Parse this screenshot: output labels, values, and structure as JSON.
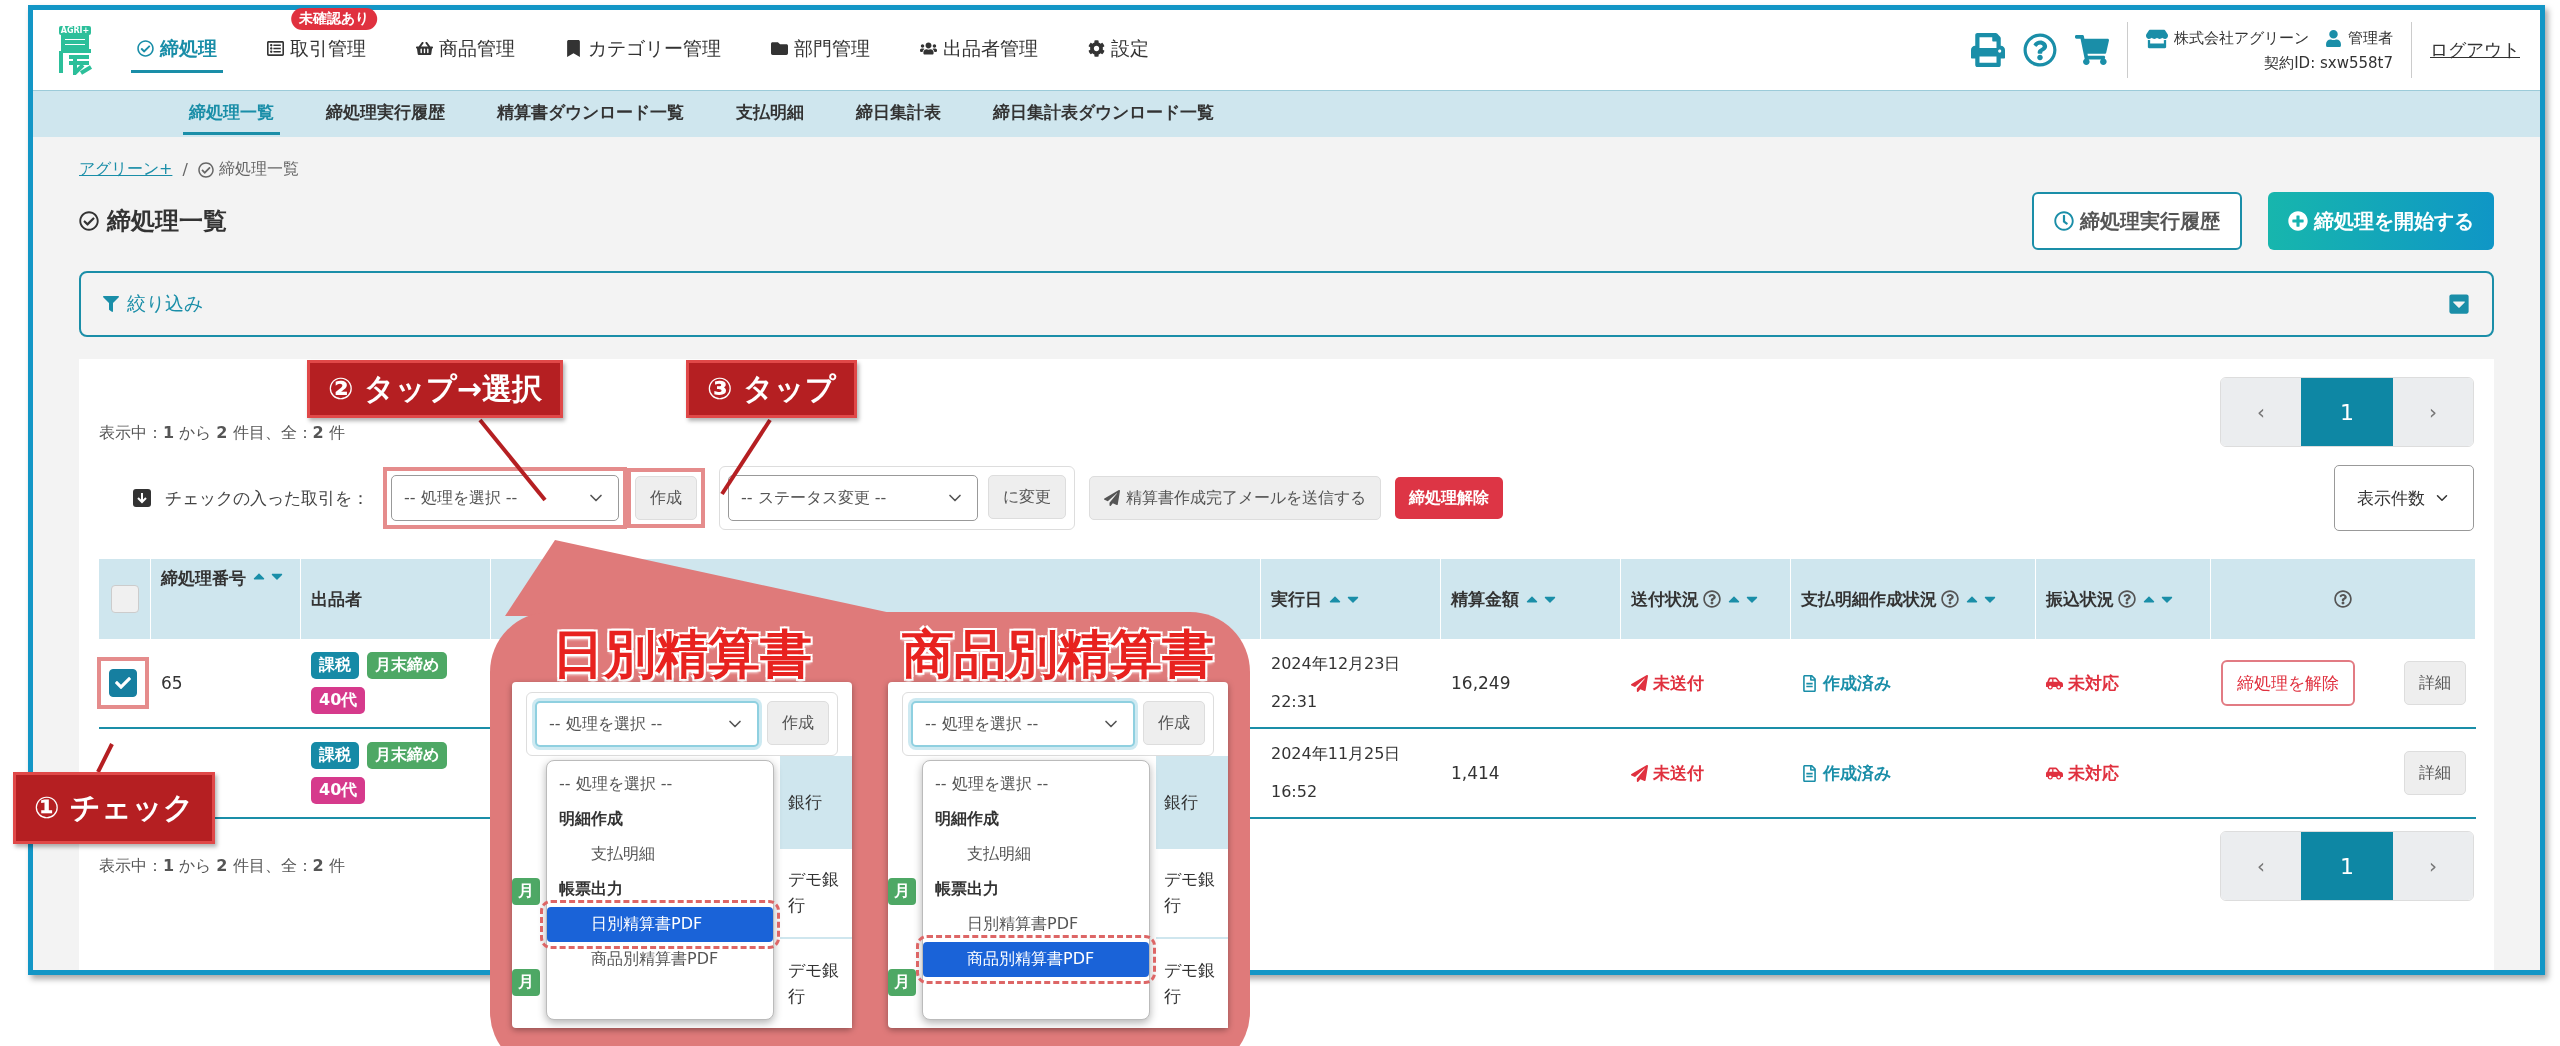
{
  "header": {
    "logo_text": "AGRI+",
    "nav": [
      {
        "label": "締処理",
        "selected": true
      },
      {
        "label": "取引管理",
        "selected": false,
        "badge": "未確認あり"
      },
      {
        "label": "商品管理",
        "selected": false
      },
      {
        "label": "カテゴリー管理",
        "selected": false
      },
      {
        "label": "部門管理",
        "selected": false
      },
      {
        "label": "出品者管理",
        "selected": false
      },
      {
        "label": "設定",
        "selected": false
      }
    ],
    "account": {
      "company": "株式会社アグリーン",
      "role": "管理者",
      "contract": "契約ID: sxw558t7",
      "logout": "ログアウト"
    }
  },
  "subnav": [
    {
      "label": "締処理一覧",
      "selected": true
    },
    {
      "label": "締処理実行履歴",
      "selected": false
    },
    {
      "label": "精算書ダウンロード一覧",
      "selected": false
    },
    {
      "label": "支払明細",
      "selected": false
    },
    {
      "label": "締日集計表",
      "selected": false
    },
    {
      "label": "締日集計表ダウンロード一覧",
      "selected": false
    }
  ],
  "breadcrumb": [
    "アグリーン+",
    "締処理一覧"
  ],
  "breadcrumb_separator": "/",
  "page_title": "締処理一覧",
  "title_buttons": {
    "history": "締処理実行履歴",
    "start": "締処理を開始する"
  },
  "filter": {
    "label": "絞り込み",
    "expanded": false
  },
  "range_text_top": "表示中：**1** から **2** 件目、全：**2** 件",
  "range_text_bottom": "表示中：**1** から **2** 件目、全：**2** 件",
  "pagination_top": {
    "prev": "‹",
    "page": "1",
    "selected": true,
    "next": "›"
  },
  "pagination_bottom": {
    "prev": "‹",
    "page": "1",
    "selected": true,
    "next": "›"
  },
  "bulk": {
    "label": "チェックの入った取引を：",
    "process_select": {
      "value": "-- 処理を選択 --",
      "highlighted": true
    },
    "create": {
      "label": "作成",
      "highlighted": true
    },
    "status_select": "-- ステータス変更 --",
    "apply": "に変更",
    "mail": "精算書作成完了メールを送信する",
    "cancel": "締処理解除",
    "per_page": "表示件数"
  },
  "table": {
    "select_all": {
      "checked": false
    },
    "columns": [
      {
        "label": "締処理番号",
        "sortable": true
      },
      {
        "label": "出品者",
        "sortable": false
      },
      {
        "label": "実行日",
        "sortable": true
      },
      {
        "label": "精算金額",
        "sortable": true
      },
      {
        "label": "送付状況",
        "sortable": true,
        "help": true
      },
      {
        "label": "支払明細作成状況",
        "sortable": true,
        "help": true
      },
      {
        "label": "振込状況",
        "sortable": true,
        "help": true
      },
      {
        "help": true,
        "sortable": false
      }
    ],
    "rows": [
      {
        "checked": true,
        "highlighted": true,
        "number": "65",
        "tags": [
          {
            "label": "課税",
            "color": "#168aa6"
          },
          {
            "label": "月末締め",
            "color": "#4ea865"
          },
          {
            "label": "40代",
            "color": "#d63a8c"
          }
        ],
        "executed_date": "2024年12月23日",
        "executed_time": "22:31",
        "amount": "16,249",
        "send_status": "未送付",
        "statement_status": "作成済み",
        "transfer_status": "未対応",
        "cancel_button": "締処理を解除",
        "detail_button": "詳細"
      },
      {
        "tags": [
          {
            "label": "課税",
            "color": "#168aa6"
          },
          {
            "label": "月末締め",
            "color": "#4ea865"
          },
          {
            "label": "40代",
            "color": "#d63a8c"
          }
        ],
        "executed_date": "2024年11月25日",
        "executed_time": "16:52",
        "amount": "1,414",
        "send_status": "未送付",
        "statement_status": "作成済み",
        "transfer_status": "未対応",
        "detail_button": "詳細"
      }
    ]
  },
  "annotations": {
    "steps": [
      "① チェック",
      "② タップ→選択",
      "③ タップ"
    ],
    "panels": [
      {
        "title": "日別精算書",
        "select": "-- 処理を選択 --",
        "create": "作成",
        "left_tags": [
          "月",
          "月"
        ],
        "side_cells": [
          "銀行",
          "デモ銀行",
          "デモ銀行"
        ],
        "options": [
          {
            "kind": "placeholder",
            "label": "-- 処理を選択 --",
            "selected": false
          },
          {
            "kind": "group",
            "label": "明細作成"
          },
          {
            "kind": "option",
            "label": "支払明細",
            "selected": false
          },
          {
            "kind": "group",
            "label": "帳票出力"
          },
          {
            "kind": "option",
            "label": "日別精算書PDF",
            "selected": true
          },
          {
            "kind": "option",
            "label": "商品別精算書PDF",
            "selected": false
          }
        ]
      },
      {
        "title": "商品別精算書",
        "select": "-- 処理を選択 --",
        "create": "作成",
        "left_tags": [
          "月",
          "月"
        ],
        "side_cells": [
          "銀行",
          "デモ銀行",
          "デモ銀行"
        ],
        "options": [
          {
            "kind": "placeholder",
            "label": "-- 処理を選択 --",
            "selected": false
          },
          {
            "kind": "group",
            "label": "明細作成"
          },
          {
            "kind": "option",
            "label": "支払明細",
            "selected": false
          },
          {
            "kind": "group",
            "label": "帳票出力"
          },
          {
            "kind": "option",
            "label": "日別精算書PDF",
            "selected": false
          },
          {
            "kind": "option",
            "label": "商品別精算書PDF",
            "selected": true
          }
        ]
      }
    ]
  }
}
